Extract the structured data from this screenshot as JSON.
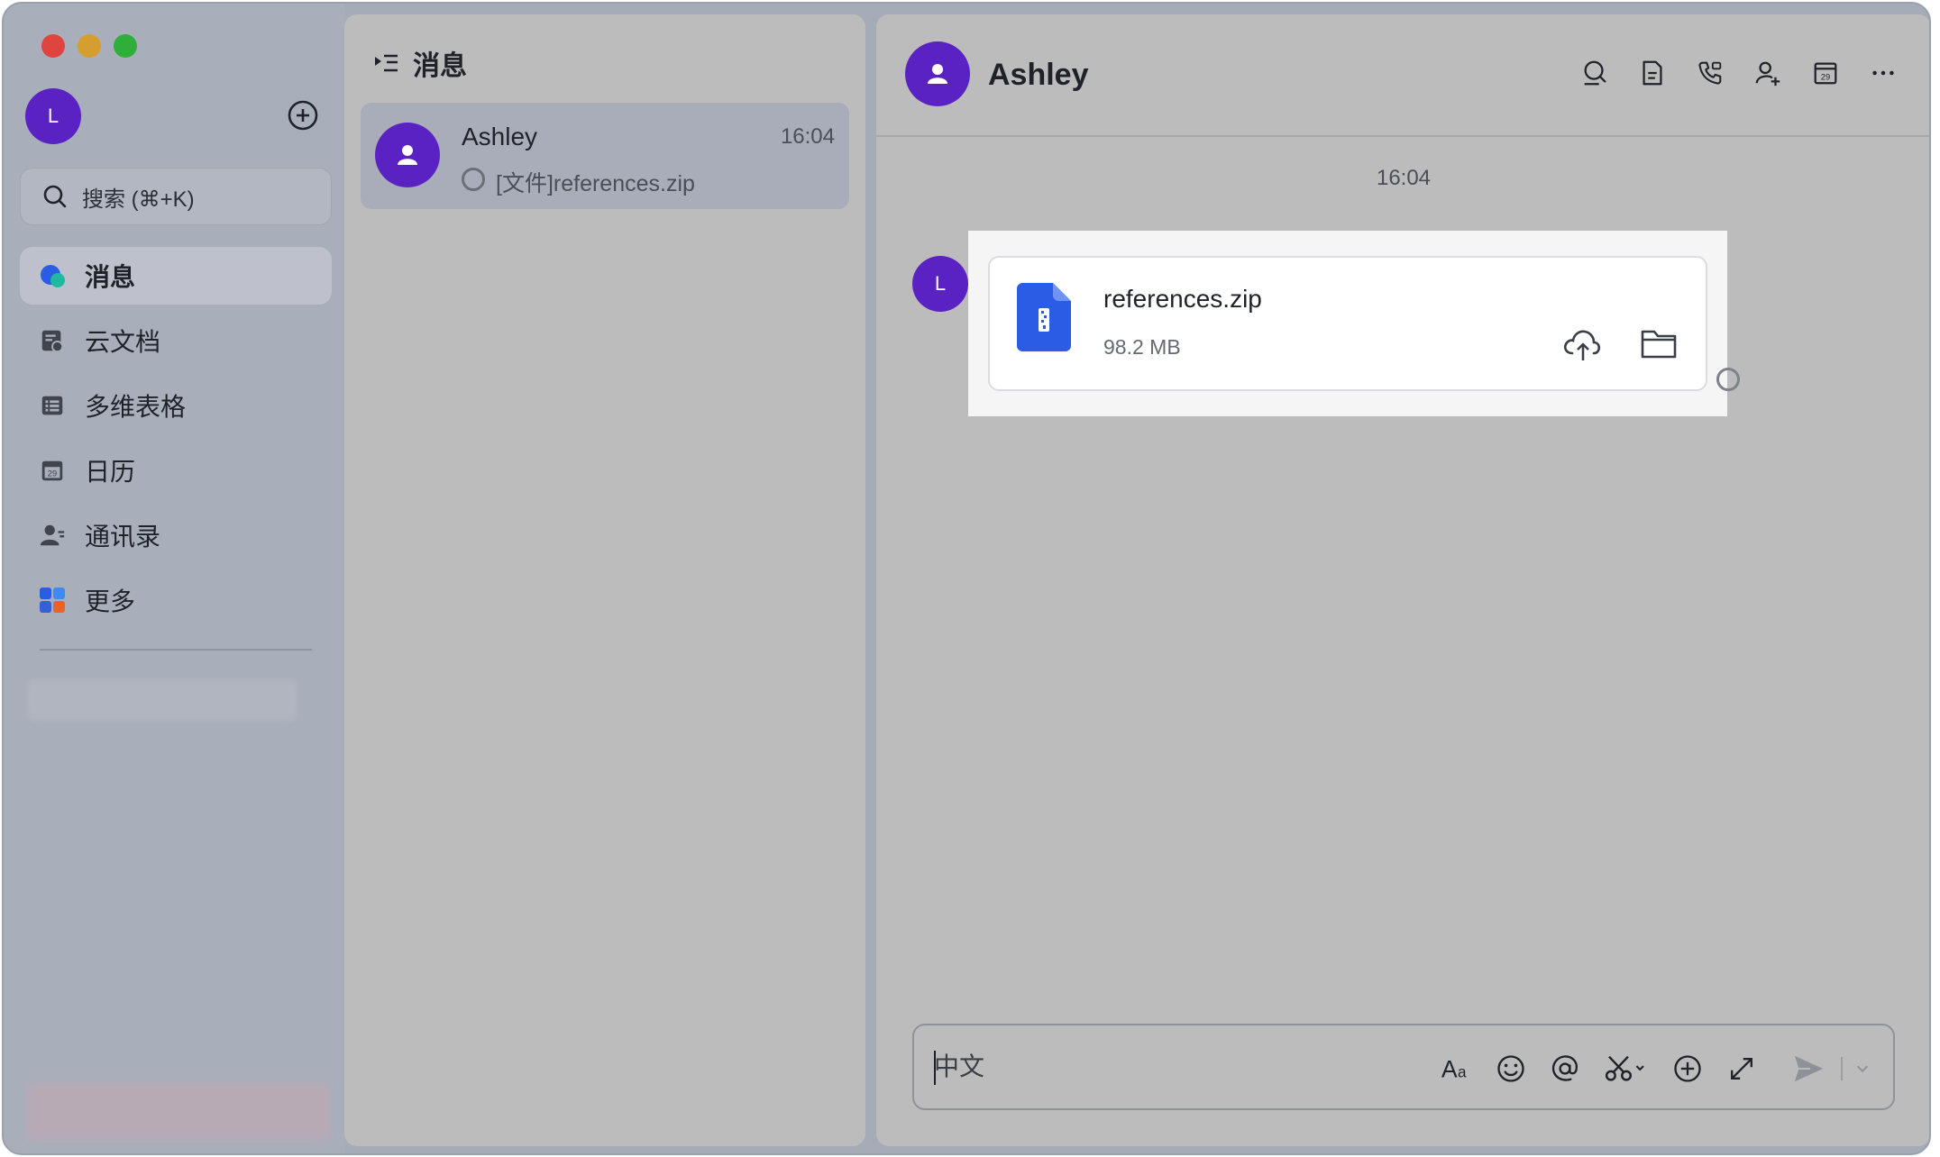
{
  "window": {
    "controls": [
      "close",
      "minimize",
      "zoom"
    ]
  },
  "sidebar": {
    "me_avatar_initial": "L",
    "search_placeholder": "搜索 (⌘+K)",
    "items": [
      {
        "label": "消息",
        "icon": "messages-icon",
        "active": true
      },
      {
        "label": "云文档",
        "icon": "cloud-docs-icon",
        "active": false
      },
      {
        "label": "多维表格",
        "icon": "base-table-icon",
        "active": false
      },
      {
        "label": "日历",
        "icon": "calendar-icon",
        "active": false
      },
      {
        "label": "通讯录",
        "icon": "contacts-icon",
        "active": false
      },
      {
        "label": "更多",
        "icon": "more-apps-icon",
        "active": false
      }
    ]
  },
  "conversation_list": {
    "title": "消息",
    "conversations": [
      {
        "name": "Ashley",
        "time": "16:04",
        "preview": "[文件]references.zip"
      }
    ]
  },
  "chat": {
    "title": "Ashley",
    "header_icons": [
      "search-icon",
      "docs-icon",
      "phone-call-icon",
      "add-member-icon",
      "calendar-icon",
      "more-icon"
    ],
    "time_divider": "16:04",
    "message": {
      "sender_initial": "L",
      "file_name": "references.zip",
      "file_size": "98.2 MB",
      "actions": [
        "cloud-upload-icon",
        "folder-icon"
      ]
    },
    "composer": {
      "placeholder": "中文",
      "tools": [
        "font-format-icon",
        "emoji-icon",
        "mention-icon",
        "screenshot-icon",
        "add-icon",
        "expand-icon",
        "send-icon"
      ]
    }
  },
  "colors": {
    "avatar_purple": "#5a22c2",
    "file_blue": "#2b5ce6",
    "traffic_red": "#e0443e",
    "traffic_yellow": "#d69e2e",
    "traffic_green": "#2fae3a"
  }
}
